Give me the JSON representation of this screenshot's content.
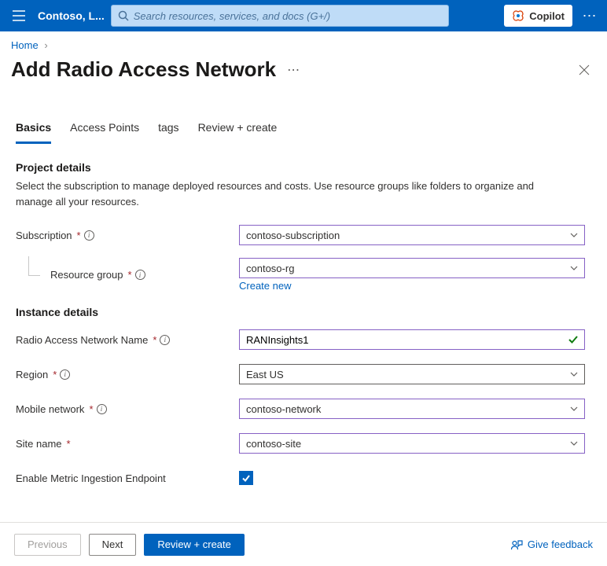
{
  "header": {
    "tenant": "Contoso, L...",
    "search_placeholder": "Search resources, services, and docs (G+/)",
    "copilot_label": "Copilot"
  },
  "breadcrumb": {
    "home": "Home"
  },
  "page": {
    "title": "Add Radio Access Network"
  },
  "tabs": [
    {
      "label": "Basics"
    },
    {
      "label": "Access Points"
    },
    {
      "label": "tags"
    },
    {
      "label": "Review + create"
    }
  ],
  "sections": {
    "project": {
      "title": "Project details",
      "desc": "Select the subscription to manage deployed resources and costs. Use resource groups like folders to organize and manage all your resources."
    },
    "instance": {
      "title": "Instance details"
    }
  },
  "fields": {
    "subscription": {
      "label": "Subscription",
      "value": "contoso-subscription"
    },
    "resource_group": {
      "label": "Resource group",
      "value": "contoso-rg",
      "create_new": "Create new"
    },
    "ran_name": {
      "label": "Radio Access Network Name",
      "value": "RANInsights1"
    },
    "region": {
      "label": "Region",
      "value": "East US"
    },
    "mobile_network": {
      "label": "Mobile network",
      "value": "contoso-network"
    },
    "site_name": {
      "label": "Site name",
      "value": "contoso-site"
    },
    "enable_metric": {
      "label": "Enable Metric Ingestion Endpoint",
      "checked": true
    }
  },
  "footer": {
    "previous": "Previous",
    "next": "Next",
    "review_create": "Review + create",
    "feedback": "Give feedback"
  }
}
